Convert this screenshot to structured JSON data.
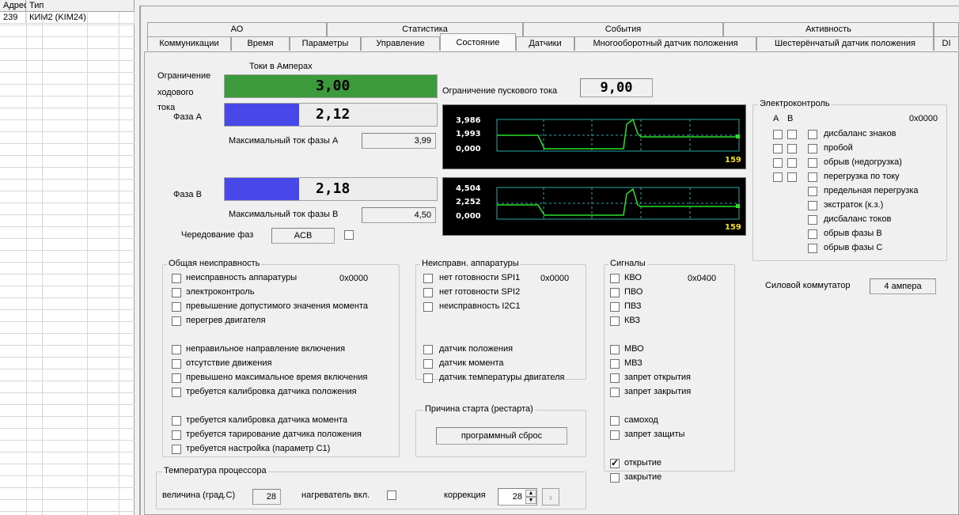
{
  "grid": {
    "headers": [
      "Адрес",
      "Тип"
    ],
    "rows": [
      [
        "239",
        "КИМ2 (KIM24)"
      ]
    ]
  },
  "tabs_top": [
    "АО",
    "Статистика",
    "События",
    "Активность"
  ],
  "tabs_bottom": [
    "Коммуникации",
    "Время",
    "Параметры",
    "Управление",
    "Состояние",
    "Датчики",
    "Многооборотный датчик положения",
    "Шестерёнчатый датчик положения",
    "DI"
  ],
  "currents": {
    "header": "Токи в Амперах",
    "limit_label_1": "Ограничение",
    "limit_label_2": "ходового",
    "limit_label_3": "тока",
    "limit_value": "3,00",
    "phase_a_label": "Фаза А",
    "phase_a_value": "2,12",
    "phase_a_fill": 0.35,
    "max_a_label": "Максимальный ток фазы А",
    "max_a_value": "3,99",
    "phase_b_label": "Фаза В",
    "phase_b_value": "2,18",
    "phase_b_fill": 0.35,
    "max_b_label": "Максимальный ток фазы В",
    "max_b_value": "4,50",
    "rotation_label": "Чередование фаз",
    "rotation_value": "ACB",
    "start_limit_label": "Ограничение пускового тока",
    "start_limit_value": "9,00",
    "colors": {
      "limit": "#3c9a3c",
      "phase": "#4848e8"
    }
  },
  "scope1": {
    "ticks": [
      "3,986",
      "1,993",
      "0,000"
    ],
    "count": "159"
  },
  "scope2": {
    "ticks": [
      "4,504",
      "2,252",
      "0,000"
    ],
    "count": "159"
  },
  "electro": {
    "title": "Электроконтроль",
    "col_a": "А",
    "col_b": "В",
    "code": "0x0000",
    "items": [
      "дисбаланс знаков",
      "пробой",
      "обрыв (недогрузка)",
      "перегрузка по току",
      "предельная перегрузка",
      "экстраток (к.з.)",
      "дисбаланс токов",
      "обрыв фазы В",
      "обрыв фазы С"
    ]
  },
  "switch": {
    "label": "Силовой коммутатор",
    "value": "4 ампера"
  },
  "general": {
    "title": "Общая неисправность",
    "code": "0x0000",
    "items": [
      "неисправность аппаратуры",
      "электроконтроль",
      "превышение допустимого значения момента",
      "перегрев двигателя",
      "неправильное направление включения",
      "отсутствие движения",
      "превышено максимальное время включения",
      "требуется калибровка датчика положения",
      "требуется калибровка датчика момента",
      "требуется тарирование датчика положения",
      "требуется настройка (параметр С1)"
    ]
  },
  "hardware": {
    "title": "Неисправн. аппаратуры",
    "code": "0x0000",
    "items": [
      "нет готовности SPI1",
      "нет готовности SPI2",
      "неисправность I2C1",
      "датчик положения",
      "датчик момента",
      "датчик температуры двигателя"
    ]
  },
  "restart": {
    "title": "Причина старта (рестарта)",
    "value": "программный сброс"
  },
  "signals": {
    "title": "Сигналы",
    "code": "0x0400",
    "items": [
      "КВО",
      "ПВО",
      "ПВЗ",
      "КВЗ",
      "МВО",
      "МВЗ",
      "запрет открытия",
      "запрет закрытия",
      "самоход",
      "запрет защиты",
      "открытие",
      "закрытие"
    ],
    "checked_index": 10
  },
  "temperature": {
    "title": "Температура процессора",
    "value_label": "величина (град.С)",
    "value": "28",
    "heater_label": "нагреватель вкл.",
    "correction_label": "коррекция",
    "correction_value": "28",
    "arrow": "›"
  }
}
